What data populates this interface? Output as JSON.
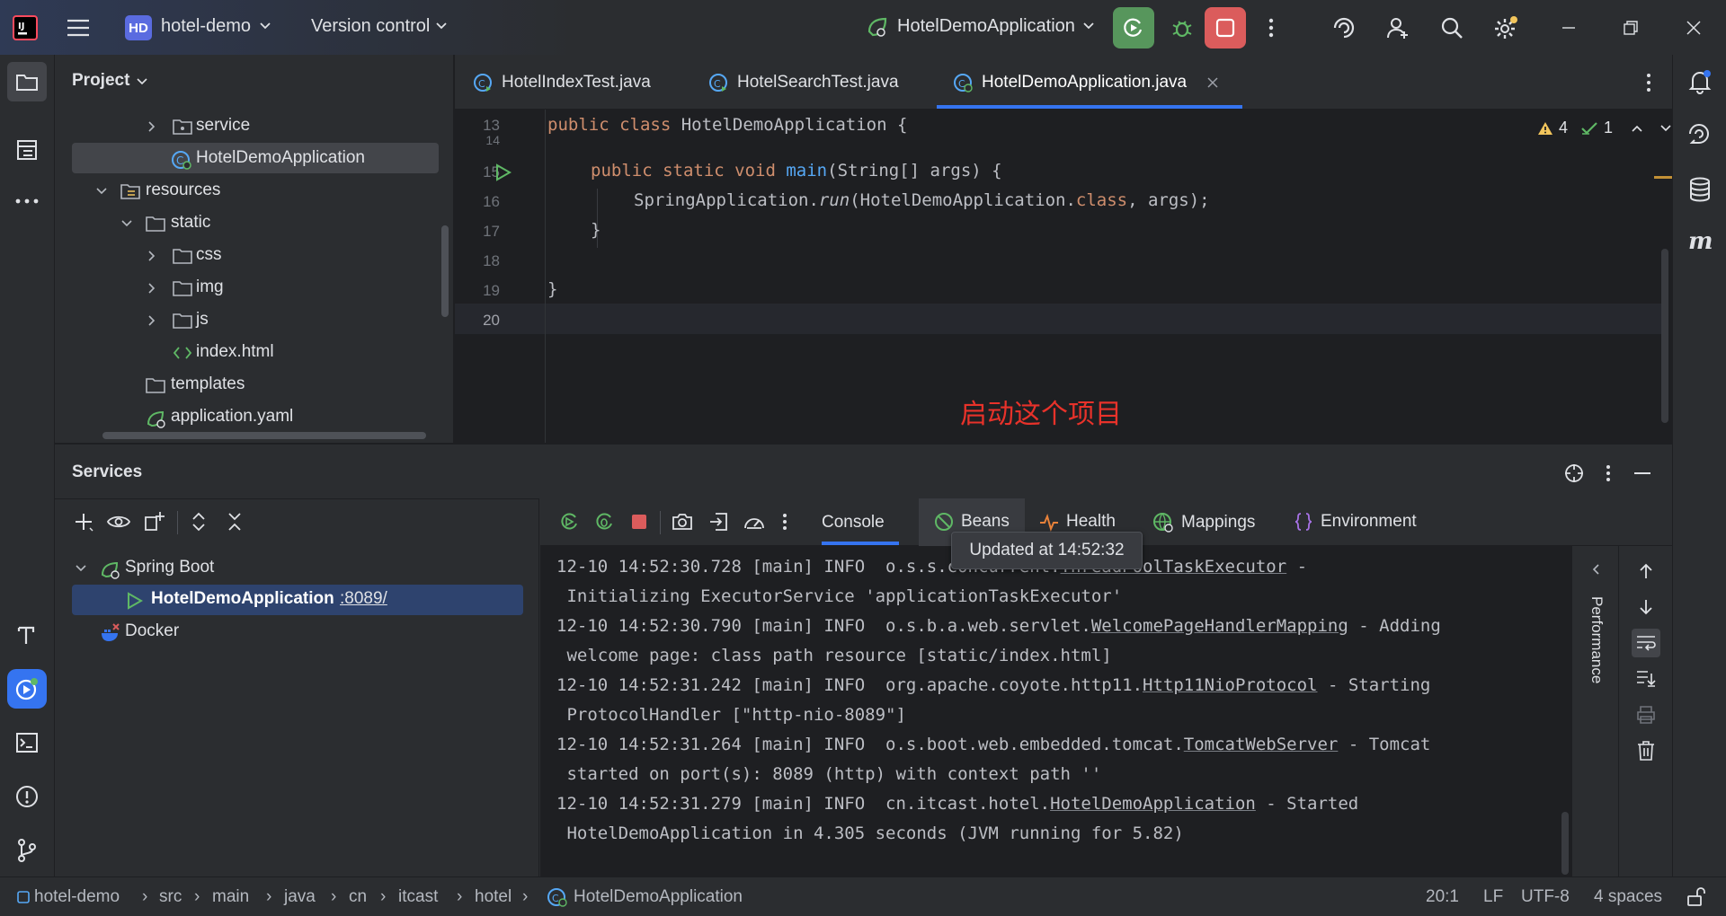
{
  "titlebar": {
    "project_badge": "HD",
    "project_name": "hotel-demo",
    "vcs_menu": "Version control",
    "run_config": "HotelDemoApplication"
  },
  "project_panel": {
    "title": "Project",
    "tree": [
      {
        "label": "service",
        "type": "folder"
      },
      {
        "label": "HotelDemoApplication",
        "type": "spring-class"
      },
      {
        "label": "resources",
        "type": "folder"
      },
      {
        "label": "static",
        "type": "folder"
      },
      {
        "label": "css",
        "type": "folder"
      },
      {
        "label": "img",
        "type": "folder"
      },
      {
        "label": "js",
        "type": "folder"
      },
      {
        "label": "index.html",
        "type": "html"
      },
      {
        "label": "templates",
        "type": "folder"
      },
      {
        "label": "application.yaml",
        "type": "yaml"
      }
    ]
  },
  "editor": {
    "tabs": [
      {
        "label": "HotelIndexTest.java"
      },
      {
        "label": "HotelSearchTest.java"
      },
      {
        "label": "HotelDemoApplication.java"
      }
    ],
    "warnings": "4",
    "checks": "1",
    "lines": [
      "13",
      "14",
      "15",
      "16",
      "17",
      "18",
      "19",
      "20"
    ],
    "code": {
      "l13_kw1": "public",
      "l13_kw2": "class",
      "l13_rest": " HotelDemoApplication {",
      "l15_kw": "public static void",
      "l15_fn": "main",
      "l15_rest": "(String[] args) {",
      "l16_a": "SpringApplication.",
      "l16_run": "run",
      "l16_b": "(HotelDemoApplication.",
      "l16_class": "class",
      "l16_c": ", args);",
      "l17": "}",
      "l19": "}"
    },
    "annotation": "启动这个项目",
    "annotation_color": "#e8322a"
  },
  "services": {
    "title": "Services",
    "tree": {
      "spring_boot": "Spring Boot",
      "app": "HotelDemoApplication",
      "port": ":8089/",
      "docker": "Docker"
    },
    "tabs": [
      "Console",
      "Beans",
      "Health",
      "Mappings",
      "Environment"
    ],
    "tooltip": "Updated at 14:52:32",
    "performance": "Performance",
    "log": [
      {
        "a": "12-10 14:52:30.728 [main] INFO  o.s.s.concurrent.",
        "u": "ThreadPoolTaskExecutor",
        "b": " -"
      },
      {
        "a": " Initializing ExecutorService 'applicationTaskExecutor'",
        "u": "",
        "b": ""
      },
      {
        "a": "12-10 14:52:30.790 [main] INFO  o.s.b.a.web.servlet.",
        "u": "WelcomePageHandlerMapping",
        "b": " - Adding"
      },
      {
        "a": " welcome page: class path resource [static/index.html]",
        "u": "",
        "b": ""
      },
      {
        "a": "12-10 14:52:31.242 [main] INFO  org.apache.coyote.http11.",
        "u": "Http11NioProtocol",
        "b": " - Starting"
      },
      {
        "a": " ProtocolHandler [\"http-nio-8089\"]",
        "u": "",
        "b": ""
      },
      {
        "a": "12-10 14:52:31.264 [main] INFO  o.s.boot.web.embedded.tomcat.",
        "u": "TomcatWebServer",
        "b": " - Tomcat"
      },
      {
        "a": " started on port(s): 8089 (http) with context path ''",
        "u": "",
        "b": ""
      },
      {
        "a": "12-10 14:52:31.279 [main] INFO  cn.itcast.hotel.",
        "u": "HotelDemoApplication",
        "b": " - Started"
      },
      {
        "a": " HotelDemoApplication in 4.305 seconds (JVM running for 5.82)",
        "u": "",
        "b": ""
      }
    ]
  },
  "statusbar": {
    "breadcrumbs": [
      "hotel-demo",
      "src",
      "main",
      "java",
      "cn",
      "itcast",
      "hotel",
      "HotelDemoApplication"
    ],
    "position": "20:1",
    "line_sep": "LF",
    "encoding": "UTF-8",
    "indent": "4 spaces"
  },
  "colors": {
    "accent": "#3574f0",
    "run_green": "#57965c",
    "stop_red": "#db5c5c",
    "keyword": "#cf8e6d",
    "function": "#56a8f5"
  }
}
